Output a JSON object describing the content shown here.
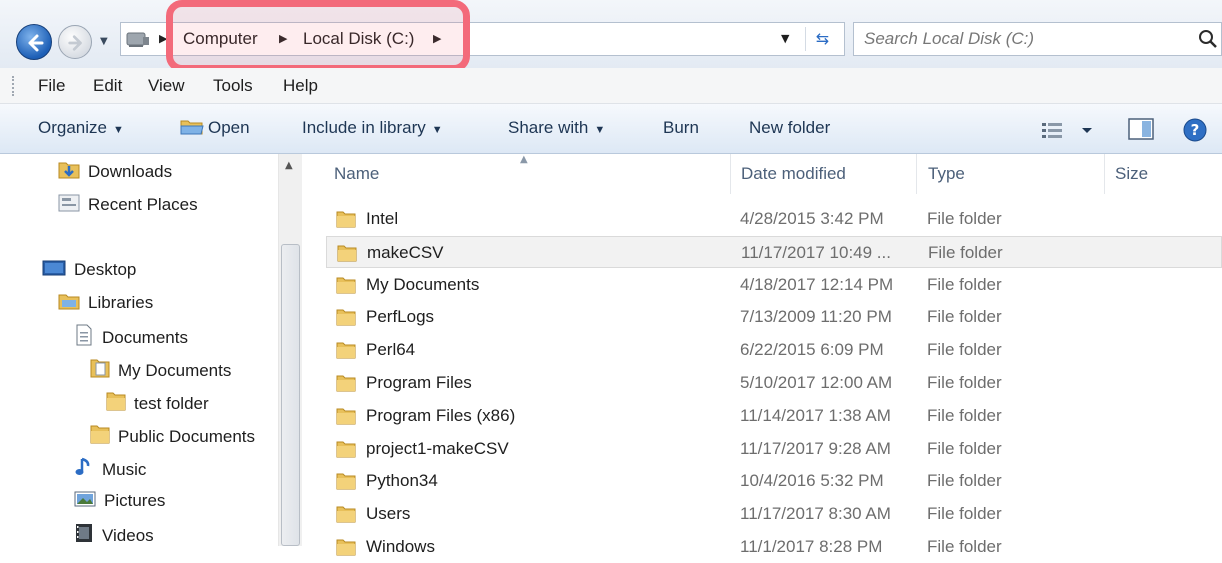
{
  "address_bar": {
    "breadcrumbs": [
      "Computer",
      "Local Disk (C:)"
    ],
    "search_placeholder": "Search Local Disk (C:)"
  },
  "menu": [
    "File",
    "Edit",
    "View",
    "Tools",
    "Help"
  ],
  "toolbar": {
    "organize": "Organize",
    "open": "Open",
    "include": "Include in library",
    "share": "Share with",
    "burn": "Burn",
    "new_folder": "New folder"
  },
  "nav_pane": {
    "items": [
      {
        "label": "Downloads",
        "icon": "downloads-icon"
      },
      {
        "label": "Recent Places",
        "icon": "recent-places-icon"
      },
      {
        "label": "Desktop",
        "icon": "desktop-icon"
      },
      {
        "label": "Libraries",
        "icon": "libraries-icon"
      },
      {
        "label": "Documents",
        "icon": "documents-icon"
      },
      {
        "label": "My Documents",
        "icon": "document-folder-icon"
      },
      {
        "label": "test folder",
        "icon": "folder-icon"
      },
      {
        "label": "Public Documents",
        "icon": "folder-icon"
      },
      {
        "label": "Music",
        "icon": "music-icon"
      },
      {
        "label": "Pictures",
        "icon": "pictures-icon"
      },
      {
        "label": "Videos",
        "icon": "videos-icon"
      }
    ]
  },
  "file_list": {
    "columns": [
      "Name",
      "Date modified",
      "Type",
      "Size"
    ],
    "rows": [
      {
        "name": "Intel",
        "date": "4/28/2015 3:42 PM",
        "type": "File folder"
      },
      {
        "name": "makeCSV",
        "date": "11/17/2017 10:49 ...",
        "type": "File folder",
        "selected": true
      },
      {
        "name": "My Documents",
        "date": "4/18/2017 12:14 PM",
        "type": "File folder"
      },
      {
        "name": "PerfLogs",
        "date": "7/13/2009 11:20 PM",
        "type": "File folder"
      },
      {
        "name": "Perl64",
        "date": "6/22/2015 6:09 PM",
        "type": "File folder"
      },
      {
        "name": "Program Files",
        "date": "5/10/2017 12:00 AM",
        "type": "File folder"
      },
      {
        "name": "Program Files (x86)",
        "date": "11/14/2017 1:38 AM",
        "type": "File folder"
      },
      {
        "name": "project1-makeCSV",
        "date": "11/17/2017 9:28 AM",
        "type": "File folder"
      },
      {
        "name": "Python34",
        "date": "10/4/2016 5:32 PM",
        "type": "File folder"
      },
      {
        "name": "Users",
        "date": "11/17/2017 8:30 AM",
        "type": "File folder"
      },
      {
        "name": "Windows",
        "date": "11/1/2017 8:28 PM",
        "type": "File folder"
      }
    ]
  },
  "colors": {
    "highlight": "#f36a7a",
    "command_text": "#1e3654",
    "header_text": "#4c607a"
  }
}
